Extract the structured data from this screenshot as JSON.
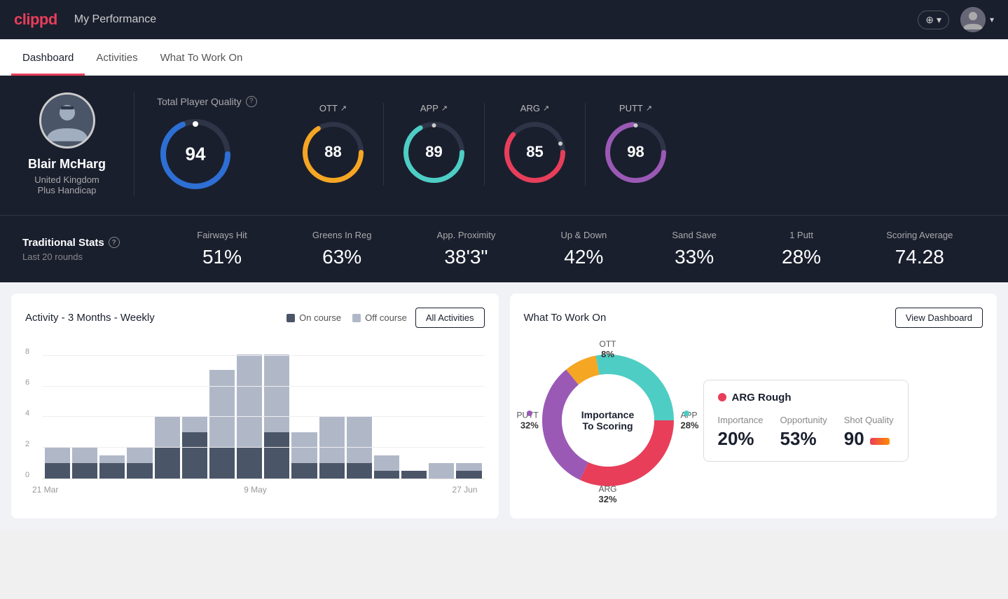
{
  "header": {
    "logo": "clippd",
    "title": "My Performance",
    "add_label": "+",
    "add_dropdown": "▾",
    "avatar_label": "U",
    "avatar_dropdown": "▾"
  },
  "tabs": [
    {
      "id": "dashboard",
      "label": "Dashboard",
      "active": true
    },
    {
      "id": "activities",
      "label": "Activities",
      "active": false
    },
    {
      "id": "what-to-work-on",
      "label": "What To Work On",
      "active": false
    }
  ],
  "player": {
    "name": "Blair McHarg",
    "country": "United Kingdom",
    "handicap": "Plus Handicap",
    "avatar_emoji": "🏌️"
  },
  "quality": {
    "label": "Total Player Quality",
    "overall": {
      "value": "94",
      "color": "#2d6fd4"
    },
    "ott": {
      "label": "OTT",
      "value": "88",
      "color": "#f5a623"
    },
    "app": {
      "label": "APP",
      "value": "89",
      "color": "#4ecdc4"
    },
    "arg": {
      "label": "ARG",
      "value": "85",
      "color": "#e83e5a"
    },
    "putt": {
      "label": "PUTT",
      "value": "98",
      "color": "#9b59b6"
    }
  },
  "trad_stats": {
    "title": "Traditional Stats",
    "subtitle": "Last 20 rounds",
    "items": [
      {
        "name": "Fairways Hit",
        "value": "51%"
      },
      {
        "name": "Greens In Reg",
        "value": "63%"
      },
      {
        "name": "App. Proximity",
        "value": "38'3\""
      },
      {
        "name": "Up & Down",
        "value": "42%"
      },
      {
        "name": "Sand Save",
        "value": "33%"
      },
      {
        "name": "1 Putt",
        "value": "28%"
      },
      {
        "name": "Scoring Average",
        "value": "74.28"
      }
    ]
  },
  "activity": {
    "title": "Activity - 3 Months - Weekly",
    "legend": {
      "on_course": "On course",
      "off_course": "Off course"
    },
    "all_activities_btn": "All Activities",
    "bars": [
      {
        "on": 1,
        "off": 1
      },
      {
        "on": 1,
        "off": 1
      },
      {
        "on": 1,
        "off": 0.5
      },
      {
        "on": 1,
        "off": 1
      },
      {
        "on": 2,
        "off": 2
      },
      {
        "on": 3,
        "off": 1
      },
      {
        "on": 2,
        "off": 5
      },
      {
        "on": 2,
        "off": 6
      },
      {
        "on": 3,
        "off": 5
      },
      {
        "on": 1,
        "off": 2
      },
      {
        "on": 1,
        "off": 3
      },
      {
        "on": 1,
        "off": 3
      },
      {
        "on": 0.5,
        "off": 1
      },
      {
        "on": 0.5,
        "off": 0
      },
      {
        "on": 0,
        "off": 1
      },
      {
        "on": 0.5,
        "off": 0.5
      }
    ],
    "x_labels": [
      "21 Mar",
      "9 May",
      "27 Jun"
    ],
    "y_labels": [
      "0",
      "2",
      "4",
      "6",
      "8"
    ],
    "max": 9
  },
  "what_to_work_on": {
    "title": "What To Work On",
    "view_dashboard_btn": "View Dashboard",
    "donut": {
      "center_line1": "Importance",
      "center_line2": "To Scoring",
      "segments": [
        {
          "label": "OTT",
          "value": "8%",
          "color": "#f5a623",
          "position": "top"
        },
        {
          "label": "APP",
          "value": "28%",
          "color": "#4ecdc4",
          "position": "right"
        },
        {
          "label": "ARG",
          "value": "32%",
          "color": "#e83e5a",
          "position": "bottom"
        },
        {
          "label": "PUTT",
          "value": "32%",
          "color": "#9b59b6",
          "position": "left"
        }
      ]
    },
    "detail": {
      "title": "ARG Rough",
      "dot_color": "#e83e5a",
      "metrics": [
        {
          "label": "Importance",
          "value": "20%"
        },
        {
          "label": "Opportunity",
          "value": "53%"
        },
        {
          "label": "Shot Quality",
          "value": "90"
        }
      ]
    }
  }
}
